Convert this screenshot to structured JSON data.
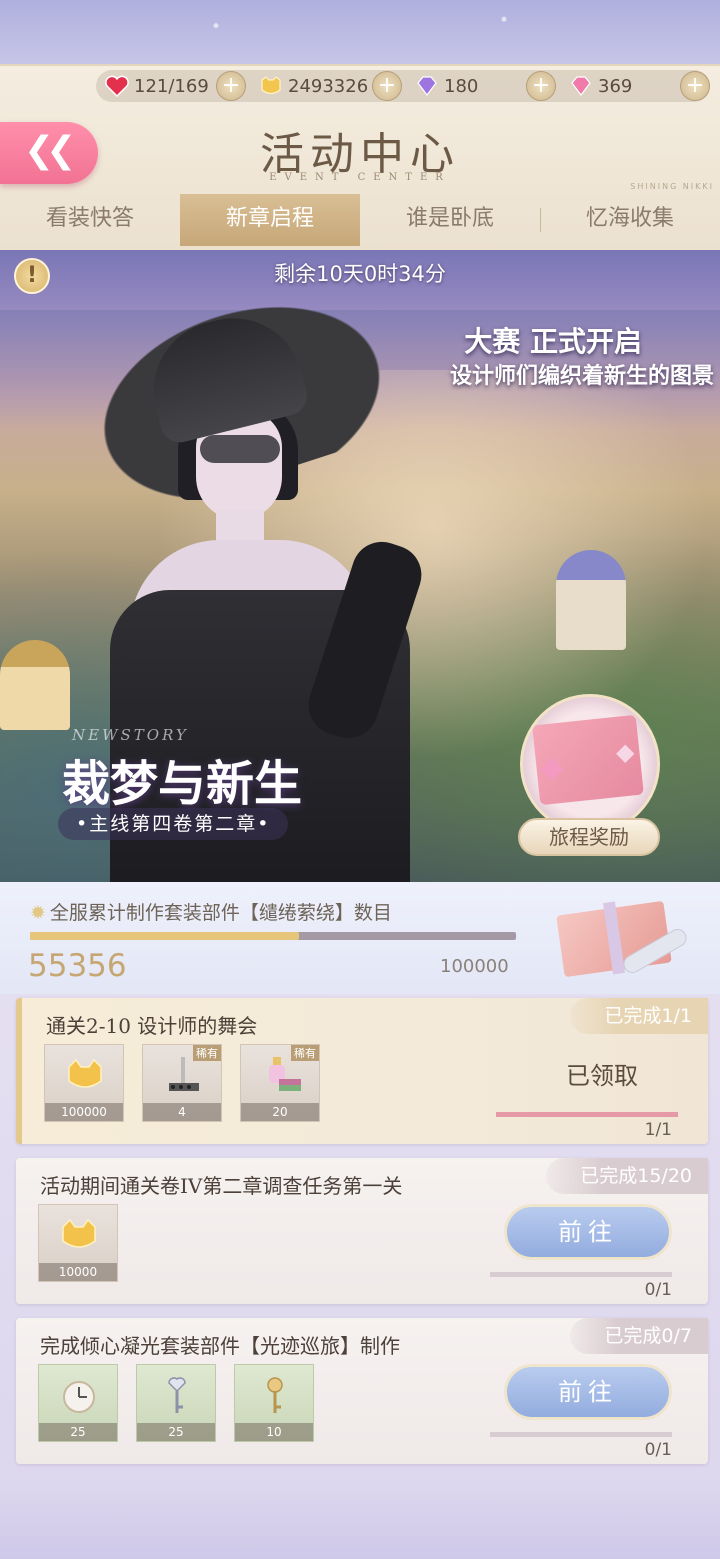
{
  "resources": [
    {
      "icon": "heart-icon",
      "value": "121/169"
    },
    {
      "icon": "coin-icon",
      "value": "2493326"
    },
    {
      "icon": "purple-diamond-icon",
      "value": "180"
    },
    {
      "icon": "pink-diamond-icon",
      "value": "369"
    }
  ],
  "header": {
    "title": "活动中心",
    "subtitle": "EVENT CENTER",
    "brand": "SHINING NIKKI"
  },
  "tabs": [
    {
      "label": "看装快答",
      "active": false
    },
    {
      "label": "新章启程",
      "active": true
    },
    {
      "label": "谁是卧底",
      "active": false
    },
    {
      "label": "忆海收集",
      "active": false
    }
  ],
  "banner": {
    "timer": "剩余10天0时34分",
    "promo_line1": "大赛 正式开启",
    "promo_line2": "设计师们编织着新生的图景",
    "story_en": "NEWSTORY",
    "story_title": "裁梦与新生",
    "story_chapter": "•主线第四卷第二章•",
    "reward_button": "旅程奖励"
  },
  "progress": {
    "label": "全服累计制作套装部件【缱绻萦绕】数目",
    "current": "55356",
    "max": "100000",
    "fraction": 0.55356
  },
  "tasks": [
    {
      "title": "通关2-10 设计师的舞会",
      "status": "已完成1/1",
      "items": [
        {
          "icon": "gold-coin-icon",
          "qty": "100000",
          "rare": ""
        },
        {
          "icon": "makeup-brush-icon",
          "qty": "4",
          "rare": "稀有"
        },
        {
          "icon": "perfume-bottle-icon",
          "qty": "20",
          "rare": "稀有"
        }
      ],
      "action": "已领取",
      "count": "1/1",
      "fraction": 1.0
    },
    {
      "title": "活动期间通关卷IV第二章调查任务第一关",
      "status": "已完成15/20",
      "items": [
        {
          "icon": "gold-coin-icon",
          "qty": "10000",
          "rare": ""
        }
      ],
      "action": "前往",
      "count": "0/1",
      "fraction": 0.0
    },
    {
      "title": "完成倾心凝光套装部件【光迹巡旅】制作",
      "status": "已完成0/7",
      "items": [
        {
          "icon": "pocket-watch-icon",
          "qty": "25",
          "rare": ""
        },
        {
          "icon": "heart-key-icon",
          "qty": "25",
          "rare": ""
        },
        {
          "icon": "flower-key-icon",
          "qty": "10",
          "rare": ""
        }
      ],
      "action": "前往",
      "count": "0/1",
      "fraction": 0.0
    }
  ]
}
